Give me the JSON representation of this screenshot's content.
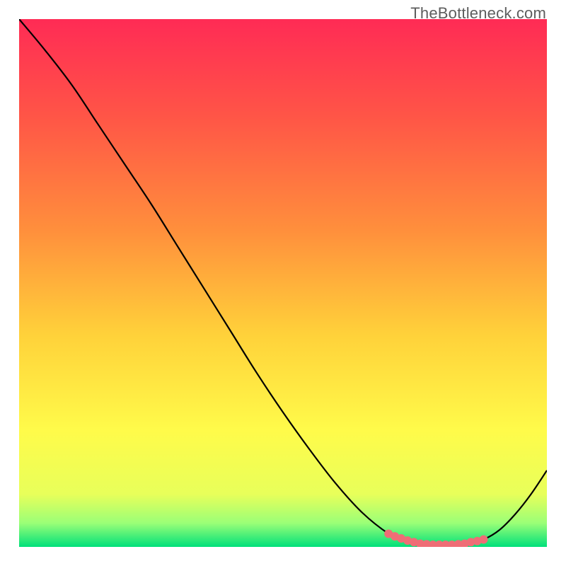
{
  "watermark": "TheBottleneck.com",
  "chart_data": {
    "type": "line",
    "title": "",
    "xlabel": "",
    "ylabel": "",
    "xlim": [
      0,
      100
    ],
    "ylim": [
      0,
      100
    ],
    "gradient_stops": [
      {
        "offset": 0.0,
        "color": "#ff2b55"
      },
      {
        "offset": 0.18,
        "color": "#ff5447"
      },
      {
        "offset": 0.4,
        "color": "#ff8f3c"
      },
      {
        "offset": 0.6,
        "color": "#ffd23a"
      },
      {
        "offset": 0.78,
        "color": "#fffb4a"
      },
      {
        "offset": 0.9,
        "color": "#e8ff5a"
      },
      {
        "offset": 0.955,
        "color": "#9aff77"
      },
      {
        "offset": 1.0,
        "color": "#00e07a"
      }
    ],
    "series": [
      {
        "name": "bottleneck-curve",
        "color": "#000000",
        "x": [
          0,
          5,
          10,
          15,
          20,
          25,
          30,
          35,
          40,
          45,
          50,
          55,
          60,
          65,
          70,
          73,
          76,
          79,
          82,
          85,
          88,
          91,
          94,
          97,
          100
        ],
        "y": [
          100,
          94,
          87.5,
          80,
          72.5,
          65,
          57,
          49,
          41,
          33,
          25.5,
          18.5,
          12,
          6.5,
          2.5,
          1.2,
          0.6,
          0.4,
          0.4,
          0.6,
          1.4,
          3.2,
          6.2,
          10.0,
          14.5
        ]
      }
    ],
    "markers": {
      "name": "optimal-zone",
      "color": "#ef6d76",
      "radius_px": 6,
      "x": [
        70.0,
        71.2,
        72.4,
        73.6,
        74.8,
        76.0,
        77.2,
        78.4,
        79.6,
        80.8,
        82.0,
        83.2,
        84.4,
        85.6,
        86.8,
        88.0
      ],
      "y": [
        2.5,
        2.0,
        1.6,
        1.2,
        0.9,
        0.6,
        0.5,
        0.4,
        0.4,
        0.4,
        0.4,
        0.5,
        0.6,
        0.9,
        1.1,
        1.4
      ]
    }
  }
}
